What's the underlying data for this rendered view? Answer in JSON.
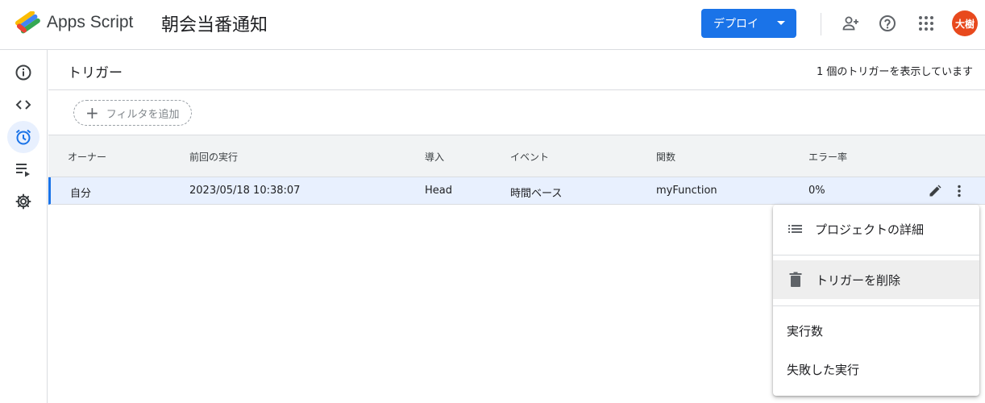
{
  "header": {
    "app_name": "Apps Script",
    "project_name": "朝会当番通知",
    "deploy_label": "デプロイ",
    "avatar_text": "大樹"
  },
  "icons": {
    "logo": "apps-script-logo",
    "add_person": "person-add-icon",
    "help": "help-icon",
    "apps": "apps-grid-icon"
  },
  "sidebar": {
    "items": [
      {
        "name": "overview",
        "icon": "info-icon"
      },
      {
        "name": "editor",
        "icon": "code-icon"
      },
      {
        "name": "triggers",
        "icon": "alarm-icon",
        "active": true
      },
      {
        "name": "executions",
        "icon": "list-play-icon"
      },
      {
        "name": "settings",
        "icon": "gear-icon"
      }
    ]
  },
  "page": {
    "title": "トリガー",
    "count_text": "1 個のトリガーを表示しています",
    "filter_label": "フィルタを追加"
  },
  "table": {
    "columns": [
      "オーナー",
      "前回の実行",
      "導入",
      "イベント",
      "関数",
      "エラー率"
    ],
    "rows": [
      {
        "owner": "自分",
        "last_run": "2023/05/18 10:38:07",
        "deployment": "Head",
        "event": "時間ベース",
        "function": "myFunction",
        "error_rate": "0%"
      }
    ]
  },
  "menu": {
    "items": [
      "プロジェクトの詳細",
      "トリガーを削除",
      "実行数",
      "失敗した実行"
    ]
  },
  "colors": {
    "accent": "#1a73e8",
    "avatar": "#e8491d",
    "selected_row": "#e8f0fe"
  }
}
